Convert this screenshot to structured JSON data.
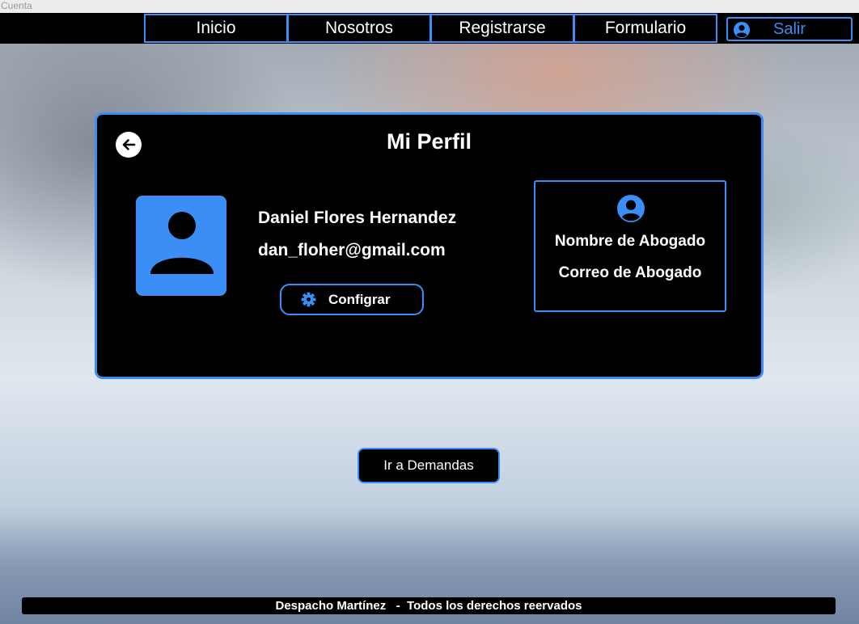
{
  "window": {
    "title": "Cuenta"
  },
  "nav": {
    "items": [
      {
        "label": "Inicio"
      },
      {
        "label": "Nosotros"
      },
      {
        "label": "Registrarse"
      },
      {
        "label": "Formulario"
      }
    ],
    "logout": {
      "label": "Salir",
      "icon": "user-circle-icon"
    }
  },
  "profile": {
    "title": "Mi Perfil",
    "back_icon": "arrow-left-icon",
    "avatar_icon": "user-icon",
    "user_name": "Daniel Flores Hernandez",
    "user_email": "dan_floher@gmail.com",
    "config_button": {
      "label": "Configrar",
      "icon": "gear-icon"
    },
    "lawyer": {
      "icon": "user-circle-icon",
      "name": "Nombre de Abogado",
      "email": "Correo de Abogado"
    }
  },
  "demands_button": {
    "label": "Ir a Demandas"
  },
  "footer": {
    "text": "Despacho Martínez   -  Todos los derechos reervados"
  },
  "colors": {
    "accent": "#3a8ef6",
    "panel": "#000000",
    "text": "#ffffff"
  }
}
